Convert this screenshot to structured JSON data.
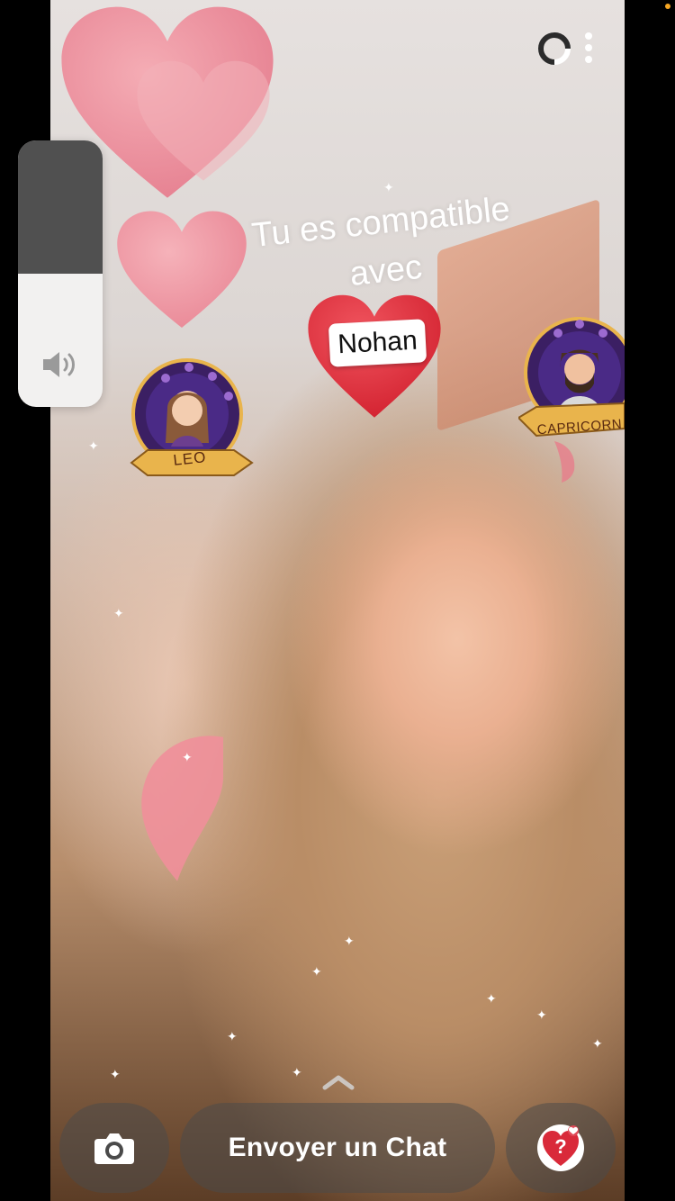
{
  "lens": {
    "line1": "Tu es compatible",
    "line2": "avec",
    "name": "Nohan",
    "sign_left": "LEO",
    "sign_right": "CAPRICORN"
  },
  "bottom_bar": {
    "send_chat_label": "Envoyer un Chat",
    "camera_icon": "camera-icon",
    "lens_icon": "question-heart-icon",
    "swipe_icon": "chevron-up-icon"
  },
  "top_bar": {
    "timer_icon": "timer-ring-icon",
    "more_icon": "more-vertical-icon"
  },
  "volume": {
    "level": 0.5,
    "icon": "speaker-icon"
  },
  "colors": {
    "heart_pink": "#ee8d98",
    "heart_red": "#e3333f",
    "badge_purple": "#3b1f63",
    "ribbon_gold": "#e9b44c",
    "status_dot": "#f5a623"
  }
}
